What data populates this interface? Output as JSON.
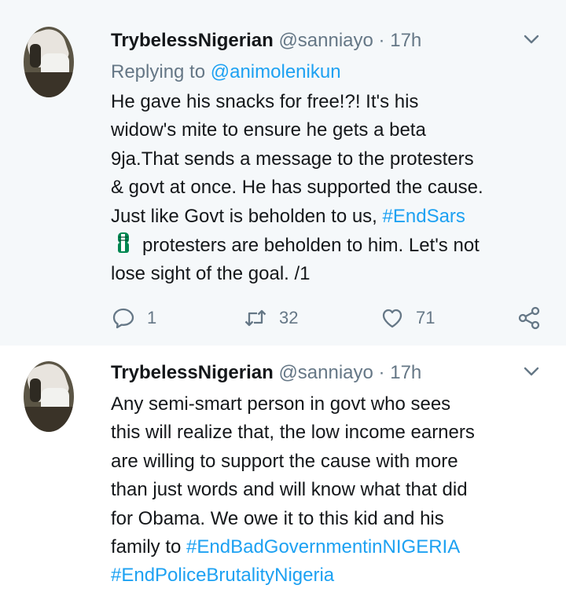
{
  "tweets": [
    {
      "name": "TrybelessNigerian",
      "handle": "@sanniayo",
      "dot": "·",
      "time": "17h",
      "reply_prefix": "Replying to",
      "reply_mention": "@animolenikun",
      "lines": {
        "l1": "He gave his snacks for free!?! It's his",
        "l2": "widow's mite to ensure he gets a beta",
        "l3": "9ja.That sends a message to the protesters",
        "l4": "& govt at once. He has supported the cause.",
        "l5_text": "Just like Govt is beholden to us, ",
        "l5_tag": "#EndSars",
        "l6": "protesters are beholden to him. Let's not",
        "l7": "lose sight of the goal. /1"
      },
      "actions": {
        "replies": "1",
        "retweets": "32",
        "likes": "71"
      }
    },
    {
      "name": "TrybelessNigerian",
      "handle": "@sanniayo",
      "dot": "·",
      "time": "17h",
      "lines": {
        "l1": "Any semi-smart person in govt who sees",
        "l2": "this will realize that, the low income earners",
        "l3": "are willing to support the cause with more",
        "l4": "than just words and will know what that did",
        "l5": "for Obama. We owe it to this kid and his",
        "l6_text": "family to ",
        "l6_tag": "#EndBadGovernmentinNIGERIA",
        "l7_tag": "#EndPoliceBrutalityNigeria"
      }
    }
  ],
  "colors": {
    "link": "#1da1f2",
    "muted": "#657786",
    "text": "#14171a",
    "highlight_bg": "#f5f8fa",
    "nigeria_green": "#008751"
  },
  "icons": [
    "chevron-down-icon",
    "reply-icon",
    "retweet-icon",
    "like-icon",
    "share-icon",
    "raised-fist-emoji"
  ]
}
